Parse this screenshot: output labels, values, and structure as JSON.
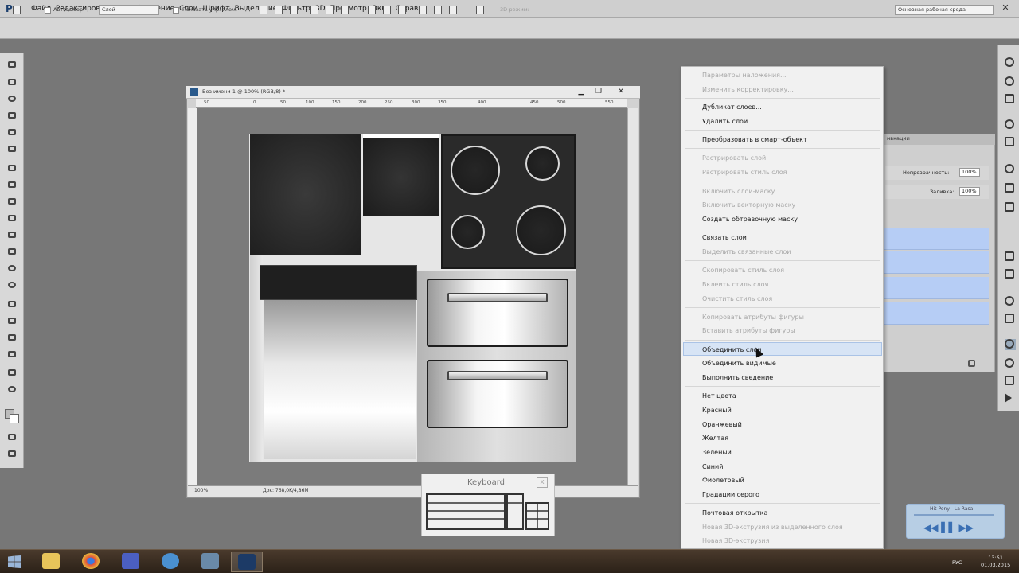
{
  "app": {
    "logo": "Ps",
    "menu": [
      "Файл",
      "Редактирование",
      "Изображение",
      "Слои",
      "Шрифт",
      "Выделение",
      "Фильтр",
      "3D",
      "Просмотр",
      "Окно",
      "Справка"
    ]
  },
  "options": {
    "autoselect_label": "Автовыбор:",
    "autoselect_value": "Слой",
    "show_controls_label": "Показать упр. элем.",
    "mode_3d": "3D-режим:",
    "workspace": "Основная рабочая среда"
  },
  "document": {
    "title": "Без имени-1 @ 100% (RGB/8) *",
    "zoom": "100%",
    "doc_info": "Док: 768,0K/4,86M",
    "ruler_ticks": [
      "50",
      "0",
      "50",
      "100",
      "150",
      "200",
      "250",
      "300",
      "350",
      "400",
      "450",
      "500",
      "550"
    ]
  },
  "panel": {
    "opacity_label": "Непрозрачность:",
    "opacity_value": "100%",
    "fill_label": "Заливка:",
    "fill_value": "100%",
    "tab_label": "нвкации"
  },
  "context_menu": {
    "items": [
      {
        "label": "Параметры наложения...",
        "disabled": true
      },
      {
        "label": "Изменить корректировку...",
        "disabled": true
      },
      {
        "label": "Дубликат слоев...",
        "disabled": false
      },
      {
        "label": "Удалить слои",
        "disabled": false
      },
      {
        "label": "Преобразовать в смарт-объект",
        "disabled": false
      },
      {
        "label": "Растрировать слой",
        "disabled": true
      },
      {
        "label": "Растрировать стиль слоя",
        "disabled": true
      },
      {
        "label": "Включить слой-маску",
        "disabled": true
      },
      {
        "label": "Включить векторную маску",
        "disabled": true
      },
      {
        "label": "Создать обтравочную маску",
        "disabled": false
      },
      {
        "label": "Связать слои",
        "disabled": false
      },
      {
        "label": "Выделить связанные слои",
        "disabled": true
      },
      {
        "label": "Скопировать стиль слоя",
        "disabled": true
      },
      {
        "label": "Вклеить стиль слоя",
        "disabled": true
      },
      {
        "label": "Очистить стиль слоя",
        "disabled": true
      },
      {
        "label": "Копировать атрибуты фигуры",
        "disabled": true
      },
      {
        "label": "Вставить атрибуты фигуры",
        "disabled": true
      },
      {
        "label": "Объединить слои",
        "disabled": false
      },
      {
        "label": "Объединить видимые",
        "disabled": false
      },
      {
        "label": "Выполнить сведение",
        "disabled": false
      },
      {
        "label": "Нет цвета",
        "disabled": false
      },
      {
        "label": "Красный",
        "disabled": false
      },
      {
        "label": "Оранжевый",
        "disabled": false
      },
      {
        "label": "Желтая",
        "disabled": false
      },
      {
        "label": "Зеленый",
        "disabled": false
      },
      {
        "label": "Синий",
        "disabled": false
      },
      {
        "label": "Фиолетовый",
        "disabled": false
      },
      {
        "label": "Градации серого",
        "disabled": false
      },
      {
        "label": "Почтовая открытка",
        "disabled": false
      },
      {
        "label": "Новая 3D-экструзия из выделенного слоя",
        "disabled": true
      },
      {
        "label": "Новая 3D-экструзия",
        "disabled": true
      }
    ]
  },
  "keyboard_widget": {
    "title": "Keyboard",
    "close": "x"
  },
  "media_widget": {
    "title": "Hit Pony - La Rasa"
  },
  "taskbar": {
    "lang": "РУС",
    "time": "13:51",
    "date": "01.03.2015"
  },
  "colors": {
    "highlight": "#d7e4f5",
    "selected_layer": "#b6cdf5",
    "disabled_text": "#a7a7a7"
  }
}
